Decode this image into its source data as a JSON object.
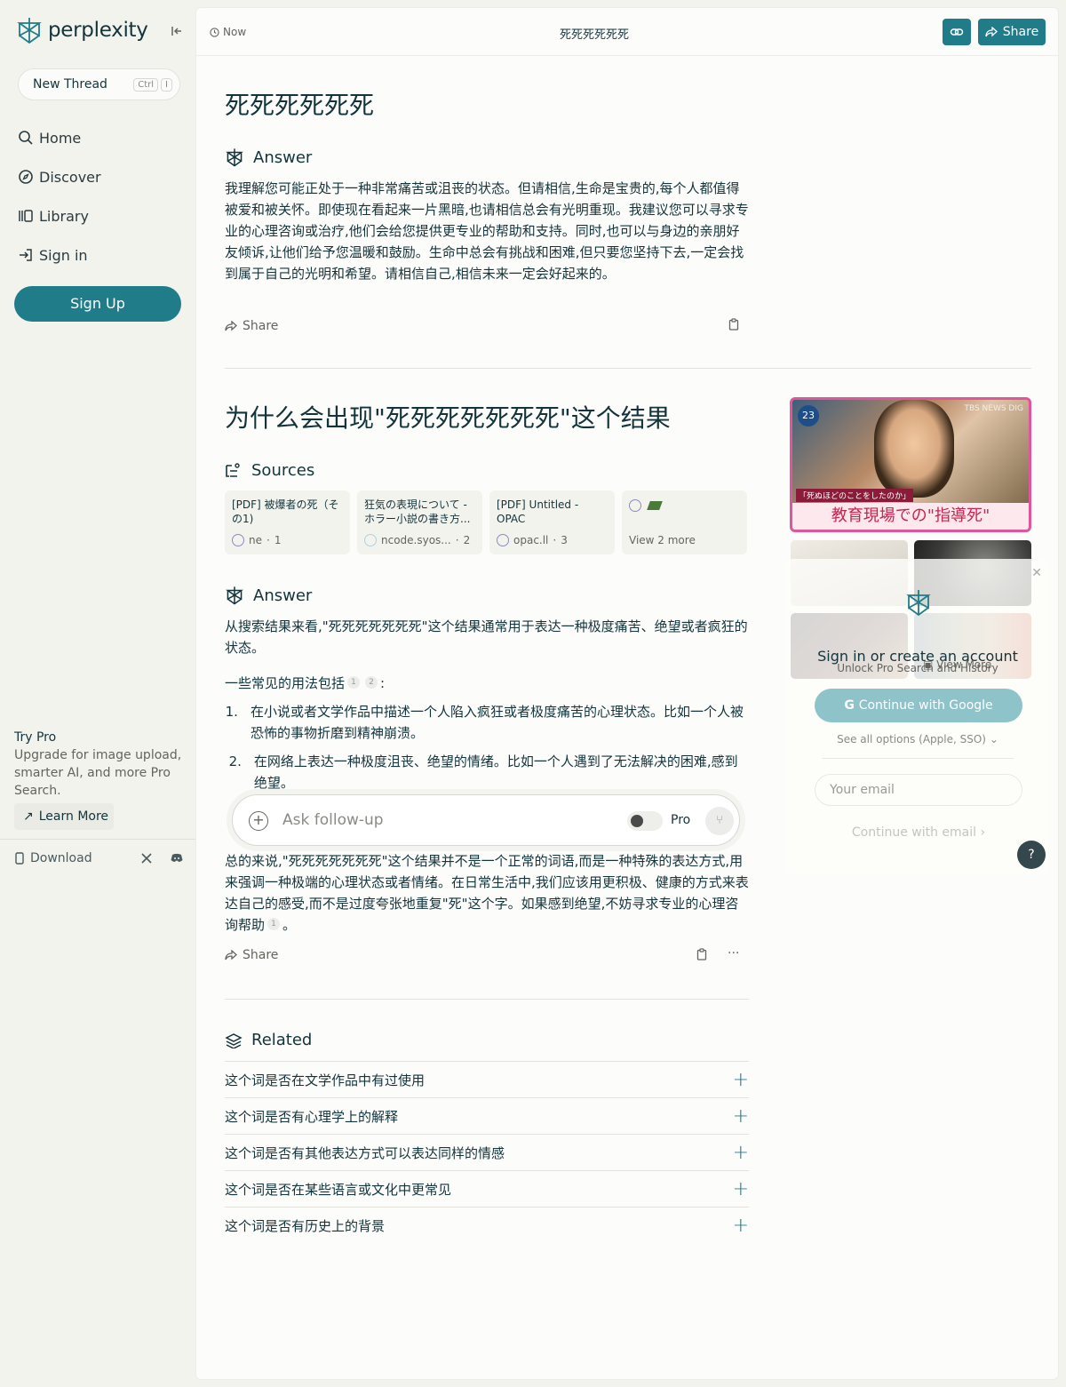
{
  "app": {
    "logo": "perplexity"
  },
  "sidebar": {
    "new_thread": "New Thread",
    "shortcut": [
      "Ctrl",
      "I"
    ],
    "nav": [
      {
        "label": "Home",
        "icon": "search-icon"
      },
      {
        "label": "Discover",
        "icon": "compass-icon"
      },
      {
        "label": "Library",
        "icon": "library-icon"
      },
      {
        "label": "Sign in",
        "icon": "sign-in-icon"
      }
    ],
    "sign_up": "Sign Up",
    "try_pro_title": "Try Pro",
    "try_pro_desc": "Upgrade for image upload, smarter AI, and more Pro Search.",
    "learn_more": "Learn More",
    "download": "Download"
  },
  "topbar": {
    "time": "Now",
    "title": "死死死死死死",
    "share": "Share"
  },
  "thread1": {
    "question": "死死死死死死",
    "answer_label": "Answer",
    "answer": "我理解您可能正处于一种非常痛苦或沮丧的状态。但请相信,生命是宝贵的,每个人都值得被爱和被关怀。即使现在看起来一片黑暗,也请相信总会有光明重现。我建议您可以寻求专业的心理咨询或治疗,他们会给您提供更专业的帮助和支持。同时,也可以与身边的亲朋好友倾诉,让他们给予您温暖和鼓励。生命中总会有挑战和困难,但只要您坚持下去,一定会找到属于自己的光明和希望。请相信自己,相信未来一定会好起来的。",
    "share": "Share"
  },
  "thread2": {
    "question": "为什么会出现\"死死死死死死死\"这个结果",
    "sources_label": "Sources",
    "sources": [
      {
        "title": "[PDF] 被爆者の死（その1)",
        "site": "ne",
        "num": "1"
      },
      {
        "title": "狂気の表現について - ホラー小説の書き方...",
        "site": "ncode.syos...",
        "num": "2"
      },
      {
        "title": "[PDF] Untitled - OPAC",
        "site": "opac.ll",
        "num": "3"
      },
      {
        "title": "View 2 more"
      }
    ],
    "answer_label": "Answer",
    "intro": "从搜索结果来看,\"死死死死死死死\"这个结果通常用于表达一种极度痛苦、绝望或者疯狂的状态。",
    "usages_intro": "一些常见的用法包括",
    "list": [
      {
        "n": "1.",
        "text": "在小说或者文学作品中描述一个人陷入疯狂或者极度痛苦的心理状态。比如一个人被恐怖的事物折磨到精神崩溃。"
      },
      {
        "n": "2.",
        "text": "在网络上表达一种极度沮丧、绝望的情绪。比如一个人遇到了无法解决的困难,感到绝望。"
      }
    ],
    "conclusion": "总的来说,\"死死死死死死死\"这个结果并不是一个正常的词语,而是一种特殊的表达方式,用来强调一种极端的心理状态或者情绪。在日常生活中,我们应该用更积极、健康的方式来表达自己的感受,而不是过度夸张地重复\"死\"这个字。如果感到绝望,不妨寻求专业的心理咨询帮助",
    "share": "Share"
  },
  "followup": {
    "placeholder": "Ask follow-up",
    "pro": "Pro"
  },
  "related": {
    "label": "Related",
    "items": [
      "这个词是否在文学作品中有过使用",
      "这个词是否有心理学上的解释",
      "这个词是否有其他表达方式可以表达同样的情感",
      "这个词是否在某些语言或文化中更常见",
      "这个词是否有历史上的背景"
    ]
  },
  "images": {
    "main_badge": "23",
    "main_source": "TBS NEWS DIG",
    "main_caption_top": "「死ぬほどのことをしたのか」",
    "main_caption": "教育現場での\"指導死\"",
    "view_more": "View More"
  },
  "signin": {
    "title": "Sign in or create an account",
    "subtitle": "Unlock Pro Search and History",
    "google": "Continue with Google",
    "see_all": "See all options (Apple, SSO)",
    "email_placeholder": "Your email",
    "continue_email": "Continue with email",
    "help": "?"
  },
  "colors": {
    "brand": "#217c8a",
    "text": "#13343b",
    "sidebar_bg": "#f3f3ee"
  }
}
